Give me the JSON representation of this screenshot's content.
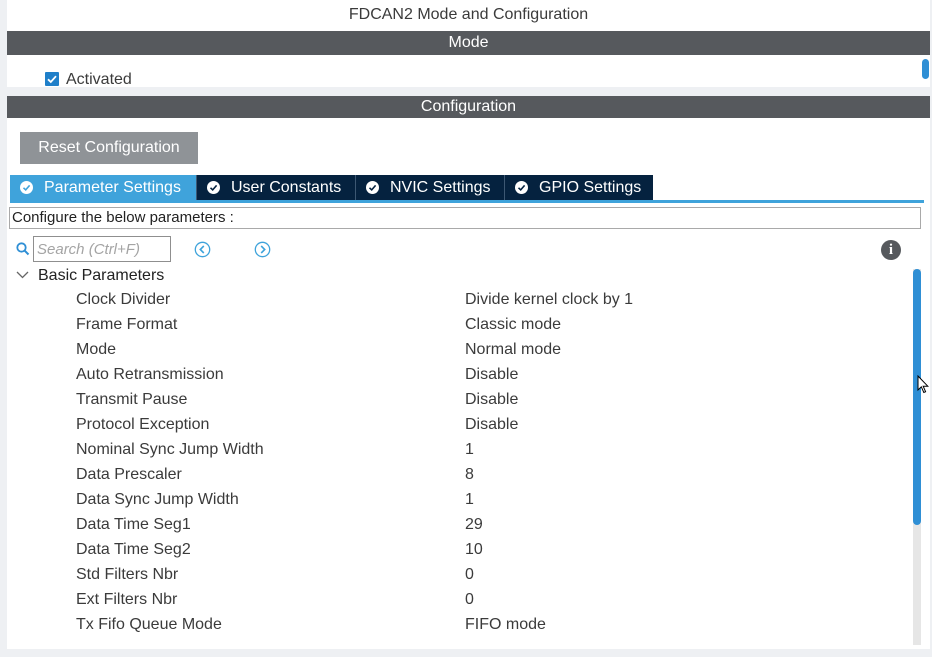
{
  "window": {
    "title": "FDCAN2 Mode and Configuration"
  },
  "mode": {
    "header": "Mode",
    "activated_label": "Activated",
    "activated_checked": true
  },
  "configuration": {
    "header": "Configuration",
    "reset_label": "Reset Configuration",
    "tabs": [
      {
        "label": "Parameter Settings",
        "active": true
      },
      {
        "label": "User Constants",
        "active": false
      },
      {
        "label": "NVIC Settings",
        "active": false
      },
      {
        "label": "GPIO Settings",
        "active": false
      }
    ],
    "configure_text": "Configure the below parameters :",
    "search": {
      "placeholder": "Search (Ctrl+F)",
      "value": ""
    },
    "group": {
      "label": "Basic Parameters",
      "params": [
        {
          "name": "Clock Divider",
          "value": "Divide kernel clock by 1"
        },
        {
          "name": "Frame Format",
          "value": "Classic mode"
        },
        {
          "name": "Mode",
          "value": "Normal mode"
        },
        {
          "name": "Auto Retransmission",
          "value": "Disable"
        },
        {
          "name": "Transmit Pause",
          "value": "Disable"
        },
        {
          "name": "Protocol Exception",
          "value": "Disable"
        },
        {
          "name": "Nominal Sync Jump Width",
          "value": "1"
        },
        {
          "name": "Data Prescaler",
          "value": "8"
        },
        {
          "name": "Data Sync Jump Width",
          "value": "1"
        },
        {
          "name": "Data Time Seg1",
          "value": "29"
        },
        {
          "name": "Data Time Seg2",
          "value": "10"
        },
        {
          "name": "Std Filters Nbr",
          "value": "0"
        },
        {
          "name": "Ext Filters Nbr",
          "value": "0"
        },
        {
          "name": "Tx Fifo Queue Mode",
          "value": "FIFO mode"
        }
      ]
    }
  },
  "icons": {
    "check": "check-icon",
    "tab_check": "check-circle-icon",
    "search": "search-icon",
    "prev": "arrow-left-circle-icon",
    "next": "arrow-right-circle-icon",
    "info": "info-icon",
    "collapse": "chevron-down-icon",
    "cursor": "mouse-cursor-icon"
  },
  "colors": {
    "accent": "#3fa3db",
    "tab_inactive": "#05223f",
    "band": "#56595d",
    "button": "#8f9397",
    "scroll_thumb": "#2f8fd5"
  }
}
